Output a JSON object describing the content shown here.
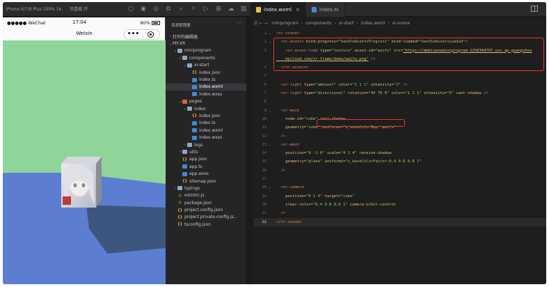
{
  "topbar": {
    "device": "iPhone 6/7/8 Plus 100% 16",
    "network": "热重载 开",
    "tabs": [
      {
        "label": "index.wxml",
        "active": true,
        "close": "×"
      },
      {
        "label": "index.ts",
        "active": false,
        "close": ""
      }
    ]
  },
  "simulator": {
    "carrier": "●●●●● WeChat",
    "time": "17:04",
    "battery": "80%",
    "title": "Weixin",
    "more": "•••",
    "colors": {
      "sky": "#8fd59a",
      "ground": "#5b7ed0",
      "plane_shadow": "#3d5680"
    }
  },
  "explorer": {
    "title": "资源管理器",
    "more": "···",
    "items": [
      {
        "depth": 0,
        "twisty": "›",
        "type": "section",
        "label": "打开的编辑器"
      },
      {
        "depth": 0,
        "twisty": "⌄",
        "type": "section",
        "label": "MY-XR"
      },
      {
        "depth": 1,
        "twisty": "⌄",
        "type": "folder",
        "label": "miniprogram"
      },
      {
        "depth": 2,
        "twisty": "⌄",
        "type": "folder",
        "label": "components"
      },
      {
        "depth": 3,
        "twisty": "⌄",
        "type": "folder",
        "label": "xr-start"
      },
      {
        "depth": 4,
        "twisty": "",
        "type": "json",
        "label": "index.json"
      },
      {
        "depth": 4,
        "twisty": "",
        "type": "ts",
        "label": "index.ts"
      },
      {
        "depth": 4,
        "twisty": "",
        "type": "wxml",
        "label": "index.wxml",
        "selected": true
      },
      {
        "depth": 4,
        "twisty": "",
        "type": "wxss",
        "label": "index.wxss"
      },
      {
        "depth": 2,
        "twisty": "⌄",
        "type": "folder-pages",
        "label": "pages"
      },
      {
        "depth": 3,
        "twisty": "⌄",
        "type": "folder",
        "label": "index"
      },
      {
        "depth": 4,
        "twisty": "",
        "type": "json",
        "label": "index.json"
      },
      {
        "depth": 4,
        "twisty": "",
        "type": "ts",
        "label": "index.ts"
      },
      {
        "depth": 4,
        "twisty": "",
        "type": "wxml",
        "label": "index.wxml"
      },
      {
        "depth": 4,
        "twisty": "",
        "type": "wxss",
        "label": "index.wxss"
      },
      {
        "depth": 3,
        "twisty": "›",
        "type": "folder",
        "label": "logs"
      },
      {
        "depth": 2,
        "twisty": "›",
        "type": "folder",
        "label": "utils"
      },
      {
        "depth": 2,
        "twisty": "",
        "type": "json",
        "label": "app.json"
      },
      {
        "depth": 2,
        "twisty": "",
        "type": "ts",
        "label": "app.ts"
      },
      {
        "depth": 2,
        "twisty": "",
        "type": "wxss",
        "label": "app.wxss"
      },
      {
        "depth": 2,
        "twisty": "",
        "type": "json",
        "label": "sitemap.json"
      },
      {
        "depth": 1,
        "twisty": "›",
        "type": "folder",
        "label": "typings"
      },
      {
        "depth": 1,
        "twisty": "",
        "type": "js",
        "label": "eslintrc.js"
      },
      {
        "depth": 1,
        "twisty": "",
        "type": "js",
        "label": "package.json"
      },
      {
        "depth": 1,
        "twisty": "",
        "type": "config",
        "label": "project.config.json"
      },
      {
        "depth": 1,
        "twisty": "",
        "type": "config",
        "label": "project.private.config.js..."
      },
      {
        "depth": 1,
        "twisty": "",
        "type": "config",
        "label": "tsconfig.json"
      }
    ]
  },
  "breadcrumb": [
    "miniprogram",
    "components",
    "xr-start",
    "index.wxml",
    "xr-scene"
  ],
  "code": {
    "current_line": 22,
    "lines": [
      {
        "n": "1",
        "fold": "⌄",
        "t": [
          [
            "<xr-scene>",
            "tg"
          ]
        ]
      },
      {
        "n": "2",
        "fold": "⌄",
        "t": [
          [
            "  <xr-assets ",
            "tg"
          ],
          [
            "bind:progress=",
            "at"
          ],
          [
            "\"handleAssetsProgress\" ",
            "vl"
          ],
          [
            "bind:loaded=",
            "at"
          ],
          [
            "\"handleAssetsLoaded\"",
            "vl"
          ],
          [
            ">",
            "tg"
          ]
        ]
      },
      {
        "n": "3",
        "fold": "",
        "t": [
          [
            "    <xr-asset-load ",
            "tg"
          ],
          [
            "type=",
            "at"
          ],
          [
            "\"texture\" ",
            "vl"
          ],
          [
            "asset-id=",
            "at"
          ],
          [
            "\"waifu\" ",
            "vl"
          ],
          [
            "src=",
            "at"
          ],
          [
            "\"https://mmbizwxaminiprogram-1258344707.cos.ap-guangzhou",
            "ur"
          ]
        ]
      },
      {
        "n": "",
        "fold": "",
        "t": [
          [
            "    mycloud.com/xr-frame/demo/waifu.png\"",
            "ur"
          ],
          [
            " />",
            "tg"
          ]
        ]
      },
      {
        "n": "4",
        "fold": "",
        "t": [
          [
            "  </xr-assets>",
            "tg"
          ]
        ]
      },
      {
        "n": "5",
        "fold": "",
        "t": []
      },
      {
        "n": "6",
        "fold": "",
        "t": [
          [
            "  <xr-light ",
            "tg"
          ],
          [
            "type=",
            "at"
          ],
          [
            "\"ambient\" ",
            "vl"
          ],
          [
            "color=",
            "at"
          ],
          [
            "\"1 1 1\" ",
            "vl"
          ],
          [
            "intensity=",
            "at"
          ],
          [
            "\"1\"",
            "vl"
          ],
          [
            " />",
            "tg"
          ]
        ]
      },
      {
        "n": "7",
        "fold": "",
        "t": [
          [
            "  <xr-light ",
            "tg"
          ],
          [
            "type=",
            "at"
          ],
          [
            "\"directional\" ",
            "vl"
          ],
          [
            "rotation=",
            "at"
          ],
          [
            "\"40 70 0\" ",
            "vl"
          ],
          [
            "color=",
            "at"
          ],
          [
            "\"1 1 1\" ",
            "vl"
          ],
          [
            "intensity=",
            "at"
          ],
          [
            "\"3\" ",
            "vl"
          ],
          [
            "cast-shadow",
            "at"
          ],
          [
            " />",
            "tg"
          ]
        ]
      },
      {
        "n": "8",
        "fold": "",
        "t": []
      },
      {
        "n": "9",
        "fold": "⌄",
        "t": [
          [
            "  <xr-mesh",
            "tg"
          ]
        ]
      },
      {
        "n": "10",
        "fold": "",
        "t": [
          [
            "    node-id=",
            "at"
          ],
          [
            "\"cube\" ",
            "vl"
          ],
          [
            "cast-shadow",
            "at"
          ]
        ]
      },
      {
        "n": "11",
        "fold": "",
        "t": [
          [
            "    geometry=",
            "at"
          ],
          [
            "\"cube\" ",
            "vl"
          ],
          [
            "uniforms=",
            "at"
          ],
          [
            "\"u_baseColorMap: waifu\"",
            "vl"
          ]
        ]
      },
      {
        "n": "12",
        "fold": "",
        "t": [
          [
            "  />",
            "tg"
          ]
        ]
      },
      {
        "n": "13",
        "fold": "⌄",
        "t": [
          [
            "  <xr-mesh",
            "tg"
          ]
        ]
      },
      {
        "n": "14",
        "fold": "",
        "t": [
          [
            "    position=",
            "at"
          ],
          [
            "\"0 -1 0\" ",
            "vl"
          ],
          [
            "scale=",
            "at"
          ],
          [
            "\"4 1 4\" ",
            "vl"
          ],
          [
            "receive-shadow",
            "at"
          ]
        ]
      },
      {
        "n": "15",
        "fold": "",
        "t": [
          [
            "    geometry=",
            "at"
          ],
          [
            "\"plane\" ",
            "vl"
          ],
          [
            "uniforms=",
            "at"
          ],
          [
            "\"u_baseColorFactor:0.4 0.6 0.8 1\"",
            "vl"
          ]
        ]
      },
      {
        "n": "16",
        "fold": "",
        "t": [
          [
            "  />",
            "tg"
          ]
        ]
      },
      {
        "n": "17",
        "fold": "",
        "t": []
      },
      {
        "n": "18",
        "fold": "⌄",
        "t": [
          [
            "  <xr-camera",
            "tg"
          ]
        ]
      },
      {
        "n": "19",
        "fold": "",
        "t": [
          [
            "    position=",
            "at"
          ],
          [
            "\"0 1 4\" ",
            "vl"
          ],
          [
            "target=",
            "at"
          ],
          [
            "\"cube\"",
            "vl"
          ]
        ]
      },
      {
        "n": "20",
        "fold": "",
        "t": [
          [
            "    clear-color=",
            "at"
          ],
          [
            "\"0.4 0.8 0.6 1\" ",
            "vl"
          ],
          [
            "camera-orbit-control",
            "at"
          ]
        ]
      },
      {
        "n": "21",
        "fold": "",
        "t": [
          [
            "  />",
            "tg"
          ]
        ]
      },
      {
        "n": "22",
        "fold": "",
        "t": [
          [
            "</xr-scene>",
            "tg"
          ]
        ]
      }
    ]
  }
}
